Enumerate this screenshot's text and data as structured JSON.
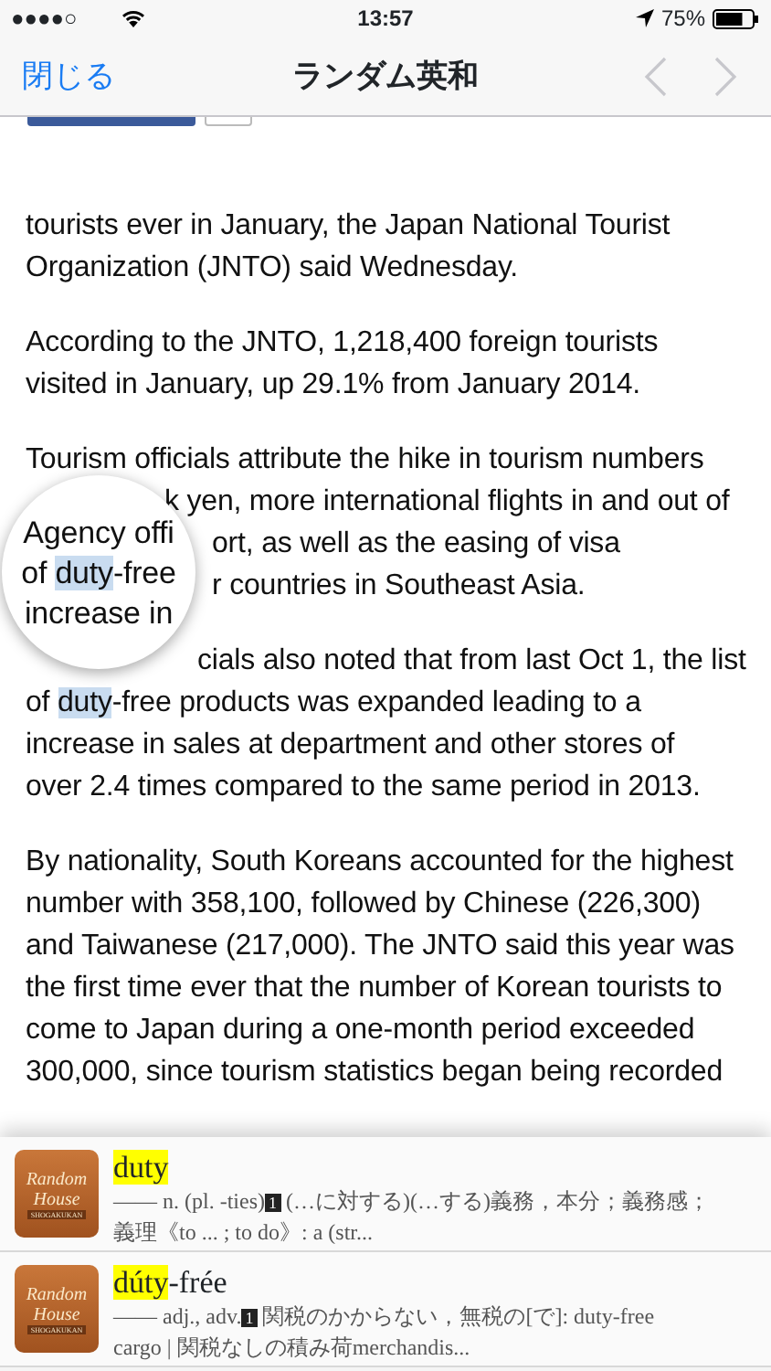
{
  "status_bar": {
    "signal": "●●●●○",
    "time": "13:57",
    "battery_text": "75%",
    "battery": {
      "level": 0.75
    }
  },
  "nav_bar": {
    "close": "閉じる",
    "title": "ランダム英和",
    "back": {
      "disabled": true
    },
    "forward": {
      "disabled": true
    }
  },
  "article": {
    "paragraphs": [
      {
        "lines": [
          {
            "text": "tourists ever in January, the Japan National Tourist"
          },
          {
            "text": "Organization (JNTO) said Wednesday."
          }
        ]
      },
      {
        "lines": [
          {
            "text": "According to the JNTO, 1,218,400 foreign tourists"
          },
          {
            "text": "visited in January, up 29.1% from January 2014."
          }
        ]
      },
      {
        "lines": [
          {
            "text": "Tourism officials attribute the hike in tourism numbers"
          },
          {
            "kind": "beside-loupe",
            "text": "k yen, more international flights in and out of"
          },
          {
            "kind": "beside-loupe",
            "text": "ort, as well as the easing of visa"
          },
          {
            "kind": "beside-loupe",
            "text": "r countries in Southeast Asia."
          }
        ]
      },
      {
        "lines": [
          {
            "kind": "beside-loupe",
            "text": "cials also noted that from last Oct 1, the list"
          },
          {
            "parts": [
              {
                "text": "of ",
                "highlighted": false
              },
              {
                "text": "duty",
                "highlighted": true
              },
              {
                "text": "-free products was expanded leading to a",
                "highlighted": false
              }
            ]
          },
          {
            "text": "increase in sales at department and other stores of"
          },
          {
            "text": "over 2.4 times compared to the same period in 2013."
          }
        ]
      },
      {
        "lines": [
          {
            "text": "By nationality, South Koreans accounted for the highest"
          },
          {
            "text": "number with 358,100, followed by Chinese (226,300)"
          },
          {
            "text": "and Taiwanese (217,000). The JNTO said this year was"
          },
          {
            "text": "the first time ever that the number of Korean tourists to"
          },
          {
            "text": "come to Japan during a one-month period exceeded"
          },
          {
            "text": "300,000, since tourism statistics began being recorded"
          }
        ]
      }
    ]
  },
  "loupe": {
    "lines": [
      {
        "parts": [
          {
            "text": "Agency offi",
            "highlighted": false
          }
        ]
      },
      {
        "parts": [
          {
            "text": "of ",
            "highlighted": false
          },
          {
            "text": "duty",
            "highlighted": true
          },
          {
            "text": "-free",
            "highlighted": false
          }
        ]
      },
      {
        "parts": [
          {
            "text": "increase in",
            "highlighted": false
          }
        ]
      }
    ]
  },
  "results": [
    {
      "cover": {
        "line_1": "Random",
        "line_2": "House",
        "publisher": "SHOGAKUKAN"
      },
      "headword": [
        {
          "text": "duty",
          "highlighted": true
        }
      ],
      "definition": {
        "lead": "—— n. (pl. -ties)",
        "sense": "1",
        "rest": " (…に対する)(…する)義務，本分；義務感；",
        "line_2": "義理《to ... ; to do》: a (str..."
      }
    },
    {
      "cover": {
        "line_1": "Random",
        "line_2": "House",
        "publisher": "SHOGAKUKAN"
      },
      "headword": [
        {
          "text": "dúty",
          "highlighted": true
        },
        {
          "text": "-frée",
          "highlighted": false
        }
      ],
      "definition": {
        "lead": "—— adj., adv.",
        "sense": "1",
        "rest": " 関税のかからない，無税の[で]: duty-free",
        "line_2": "cargo | 関税なしの積み荷merchandis..."
      }
    }
  ]
}
